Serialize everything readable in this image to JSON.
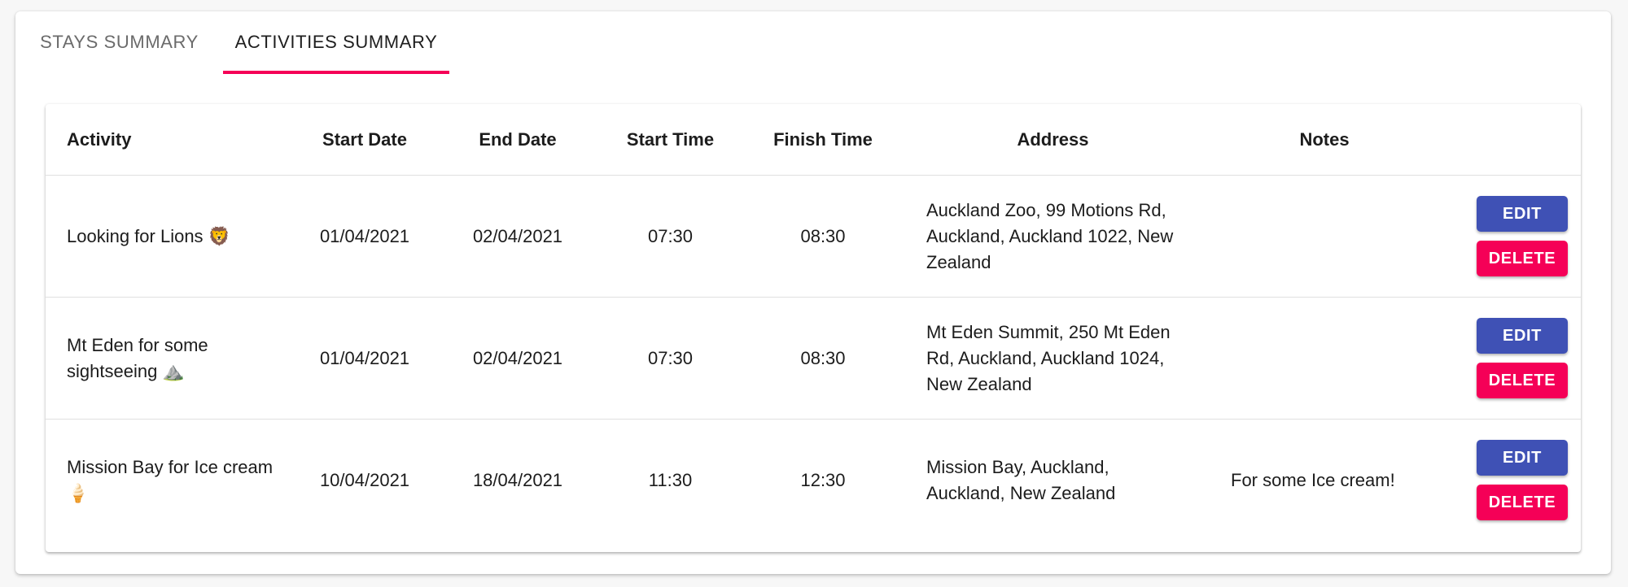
{
  "tabs": [
    {
      "label": "STAYS SUMMARY",
      "active": false
    },
    {
      "label": "ACTIVITIES SUMMARY",
      "active": true
    }
  ],
  "table": {
    "headers": {
      "activity": "Activity",
      "start_date": "Start Date",
      "end_date": "End Date",
      "start_time": "Start Time",
      "finish_time": "Finish Time",
      "address": "Address",
      "notes": "Notes"
    },
    "rows": [
      {
        "activity": "Looking for Lions 🦁",
        "start_date": "01/04/2021",
        "end_date": "02/04/2021",
        "start_time": "07:30",
        "finish_time": "08:30",
        "address": "Auckland Zoo, 99 Motions Rd, Auckland, Auckland 1022, New Zealand",
        "notes": "",
        "edit_label": "EDIT",
        "delete_label": "DELETE"
      },
      {
        "activity": "Mt Eden for some sightseeing ⛰️",
        "start_date": "01/04/2021",
        "end_date": "02/04/2021",
        "start_time": "07:30",
        "finish_time": "08:30",
        "address": "Mt Eden Summit, 250 Mt Eden Rd, Auckland, Auckland 1024, New Zealand",
        "notes": "",
        "edit_label": "EDIT",
        "delete_label": "DELETE"
      },
      {
        "activity": "Mission Bay for Ice cream 🍦",
        "start_date": "10/04/2021",
        "end_date": "18/04/2021",
        "start_time": "11:30",
        "finish_time": "12:30",
        "address": "Mission Bay, Auckland, Auckland, New Zealand",
        "notes": "For some Ice cream!",
        "edit_label": "EDIT",
        "delete_label": "DELETE"
      }
    ]
  },
  "colors": {
    "primary": "#3f51b5",
    "secondary": "#f50057"
  }
}
